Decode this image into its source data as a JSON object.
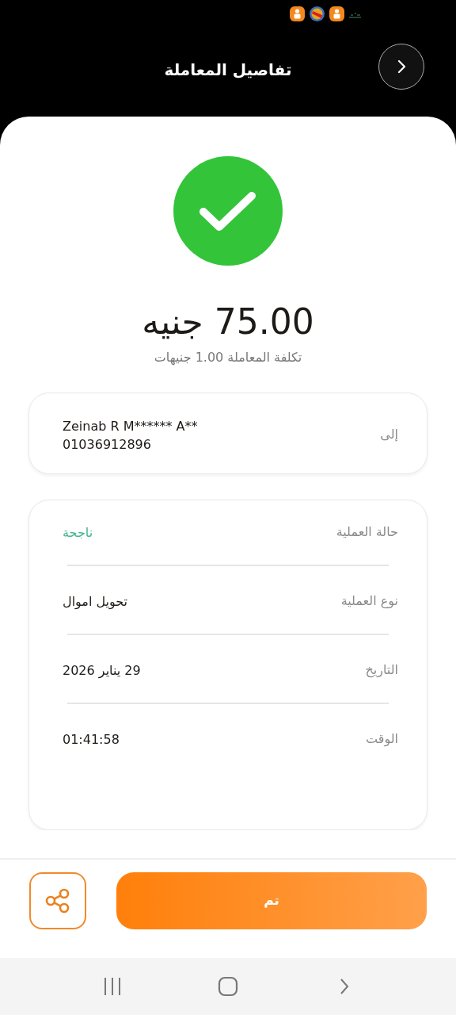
{
  "status_bar": {
    "icons": [
      {
        "kind": "app"
      },
      {
        "kind": "game"
      },
      {
        "kind": "app"
      },
      {
        "kind": "mark"
      }
    ]
  },
  "header": {
    "title": "تفاصيل المعاملة"
  },
  "result": {
    "kind": "success",
    "amount": "75.00 جنيه",
    "fee": "تكلفة المعاملة 1.00 جنيهات"
  },
  "recipient": {
    "label": "إلى",
    "name": "Zeinab R M****** A**",
    "phone": "01036912896"
  },
  "details": [
    {
      "label": "حالة العملية",
      "value": "ناجحة",
      "kind": "success"
    },
    {
      "label": "نوع العملية",
      "value": "تحويل اموال",
      "kind": "plain"
    },
    {
      "label": "التاريخ",
      "value": "29 يناير 2026",
      "kind": "plain"
    },
    {
      "label": "الوقت",
      "value": "01:41:58",
      "kind": "plain"
    }
  ],
  "actions": {
    "done": "تم"
  }
}
